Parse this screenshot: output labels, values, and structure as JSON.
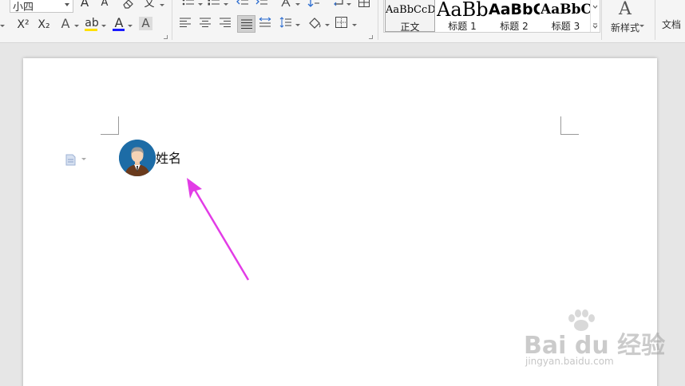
{
  "ribbon": {
    "font_size": {
      "value": "小四"
    },
    "font_group": {
      "grow_font_glyph": "A",
      "shrink_font_glyph": "A",
      "superscript_glyph": "X²",
      "subscript_glyph": "X₂",
      "text_effect_glyph": "A",
      "highlight_glyph": "ab",
      "font_color_glyph": "A",
      "char_shading_glyph": "A",
      "phonetic_glyph": "文",
      "highlight_color": "#ffe000",
      "font_color_bar": "#1a1aff"
    },
    "styles": [
      {
        "sample": "AaBbCcDd",
        "label": "正文",
        "selected": true
      },
      {
        "sample": "AaBb",
        "label": "标题 1",
        "selected": false
      },
      {
        "sample": "AaBbC",
        "label": "标题 2",
        "selected": false
      },
      {
        "sample": "AaBbCc",
        "label": "标题 3",
        "selected": false
      }
    ],
    "new_style": {
      "glyph": "A",
      "label": "新样式"
    },
    "doc_assistant": {
      "label": "文档"
    }
  },
  "document": {
    "name_text": "姓名",
    "annotation_color": "#e23ce6"
  },
  "watermark": {
    "logo": "Bai du 经验",
    "url": "jingyan.baidu.com"
  }
}
